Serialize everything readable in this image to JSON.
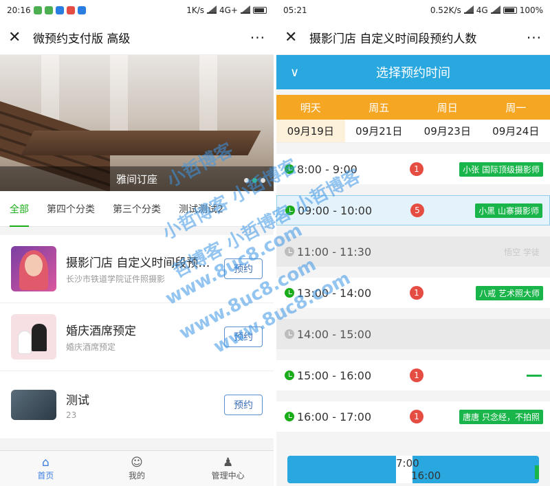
{
  "left": {
    "status": {
      "time": "20:16",
      "network": "1K/s",
      "net_type": "4G+"
    },
    "nav": {
      "title": "微预约支付版 高级",
      "close_icon": "close-icon",
      "more": "···"
    },
    "banner": {
      "caption": "雅间订座"
    },
    "tabs": [
      "全部",
      "第四个分类",
      "第三个分类",
      "测试测试2"
    ],
    "items": [
      {
        "name": "摄影门店 自定义时间段预约人数",
        "sub": "长沙市铁道学院证件照摄影",
        "button": "预约"
      },
      {
        "name": "婚庆酒席预定",
        "sub": "婚庆酒席预定",
        "button": "预约"
      },
      {
        "name": "测试",
        "sub": "23",
        "button": "预约"
      }
    ],
    "tabbar": [
      {
        "label": "首页",
        "icon": "⌂"
      },
      {
        "label": "我的",
        "icon": "☺"
      },
      {
        "label": "管理中心",
        "icon": "♟"
      }
    ]
  },
  "right": {
    "status": {
      "time": "05:21",
      "network": "0.52K/s",
      "net_type": "4G",
      "battery": "100%"
    },
    "nav": {
      "title": "摄影门店 自定义时间段预约人数",
      "more": "···"
    },
    "select_bar": {
      "label": "选择预约时间",
      "chevron": "∨"
    },
    "days": [
      "明天",
      "周五",
      "周日",
      "周一"
    ],
    "dates": [
      "09月19日",
      "09月21日",
      "09月23日",
      "09月24日"
    ],
    "slots": [
      {
        "time": "8:00 - 9:00",
        "count": "1",
        "staff": "小张 国际顶级摄影师",
        "state": "normal"
      },
      {
        "time": "09:00 - 10:00",
        "count": "5",
        "staff": "小黑 山寨摄影师",
        "state": "selected"
      },
      {
        "time": "11:00 - 11:30",
        "count": "",
        "staff": "悟空 学徒",
        "state": "disabled"
      },
      {
        "time": "13:00 - 14:00",
        "count": "1",
        "staff": "八戒 艺术照大师",
        "state": "normal"
      },
      {
        "time": "14:00 - 15:00",
        "count": "",
        "staff": "",
        "state": "disabled"
      },
      {
        "time": "15:00 - 16:00",
        "count": "1",
        "staff": "—",
        "state": "normal"
      },
      {
        "time": "16:00 - 17:00",
        "count": "1",
        "staff": "唐唐 只念经，不拍照",
        "state": "normal"
      }
    ],
    "bottom": {
      "line1": "7:00",
      "line2": "16:00"
    }
  },
  "watermark": [
    "小哲博客",
    "小哲博客 小哲博客",
    "哲博客 小哲博客 小哲博客",
    "www.8uc8.com",
    "www.8uc8.com",
    "www.8uc8.com"
  ]
}
